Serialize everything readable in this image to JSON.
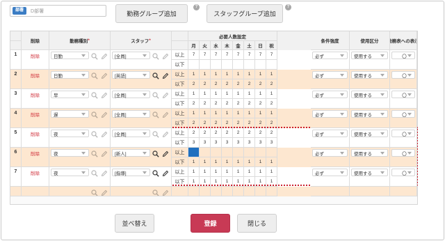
{
  "header": {
    "dept_badge": "部署",
    "dept_value": "D部署",
    "add_work_group": "勤務グループ追加",
    "add_staff_group": "スタッフグループ追加",
    "help_glyph": "?"
  },
  "columns": {
    "delete": "削除",
    "work_type": "勤務種別",
    "staff": "スタッフ",
    "required_staff": "必要人数設定",
    "days": [
      "月",
      "火",
      "水",
      "木",
      "金",
      "土",
      "日",
      "祝"
    ],
    "condition": "条件強度",
    "usage": "使用区分",
    "display": "勤務表への表示",
    "required_mark": "*"
  },
  "labels": {
    "min": "以上",
    "max": "以下"
  },
  "rows": [
    {
      "no": "1",
      "delete": "削除",
      "work_type": "日勤",
      "staff": "[全員]",
      "min": [
        "7",
        "7",
        "7",
        "7",
        "7",
        "7",
        "7",
        "7"
      ],
      "max": [
        "",
        "",
        "",
        "",
        "",
        "",
        "",
        ""
      ],
      "condition": "必ず",
      "usage": "使用する",
      "display": "〇",
      "shaded": false,
      "edit_active": false
    },
    {
      "no": "2",
      "delete": "削除",
      "work_type": "日勤",
      "staff": "[英語]",
      "min": [
        "1",
        "1",
        "1",
        "1",
        "1",
        "1",
        "1",
        "1"
      ],
      "max": [
        "2",
        "2",
        "2",
        "2",
        "2",
        "2",
        "2",
        "2"
      ],
      "condition": "必ず",
      "usage": "使用する",
      "display": "〇",
      "shaded": true,
      "edit_active": true
    },
    {
      "no": "3",
      "delete": "削除",
      "work_type": "早",
      "staff": "[全員]",
      "min": [
        "1",
        "1",
        "1",
        "1",
        "1",
        "1",
        "1",
        "1"
      ],
      "max": [
        "2",
        "2",
        "2",
        "2",
        "2",
        "2",
        "2",
        "2"
      ],
      "condition": "必ず",
      "usage": "使用する",
      "display": "〇",
      "shaded": false,
      "edit_active": false
    },
    {
      "no": "4",
      "delete": "削除",
      "work_type": "遅",
      "staff": "[全員]",
      "min": [
        "1",
        "1",
        "1",
        "1",
        "1",
        "1",
        "1",
        "1"
      ],
      "max": [
        "2",
        "2",
        "2",
        "2",
        "2",
        "2",
        "2",
        "2"
      ],
      "condition": "必ず",
      "usage": "使用する",
      "display": "〇",
      "shaded": true,
      "edit_active": false
    },
    {
      "no": "5",
      "delete": "削除",
      "work_type": "夜",
      "staff": "[全員]",
      "min": [
        "2",
        "2",
        "2",
        "2",
        "2",
        "2",
        "2",
        "2"
      ],
      "max": [
        "3",
        "3",
        "3",
        "3",
        "3",
        "3",
        "3",
        "3"
      ],
      "condition": "必ず",
      "usage": "使用する",
      "display": "〇",
      "shaded": false,
      "edit_active": false
    },
    {
      "no": "6",
      "delete": "削除",
      "work_type": "夜",
      "staff": "[新人]",
      "min": [
        "",
        "",
        "",
        "",
        "",
        "",
        "",
        ""
      ],
      "max": [
        "1",
        "1",
        "1",
        "1",
        "1",
        "1",
        "1",
        "1"
      ],
      "condition": "必ず",
      "usage": "使用する",
      "display": "〇",
      "shaded": true,
      "edit_active": true
    },
    {
      "no": "7",
      "delete": "削除",
      "work_type": "夜",
      "staff": "[指導]",
      "min": [
        "1",
        "1",
        "1",
        "1",
        "1",
        "1",
        "1",
        "1"
      ],
      "max": [
        "1",
        "1",
        "1",
        "1",
        "1",
        "1",
        "1",
        "1"
      ],
      "condition": "必ず",
      "usage": "使用する",
      "display": "〇",
      "shaded": false,
      "edit_active": true
    }
  ],
  "footer": {
    "sort": "並べ替え",
    "register": "登録",
    "close": "閉じる"
  },
  "colors": {
    "accent": "#c83a55",
    "shaded_row": "#fde7d0",
    "highlight_border": "#cc1f2c",
    "selected_cell": "#1f6fbf"
  }
}
